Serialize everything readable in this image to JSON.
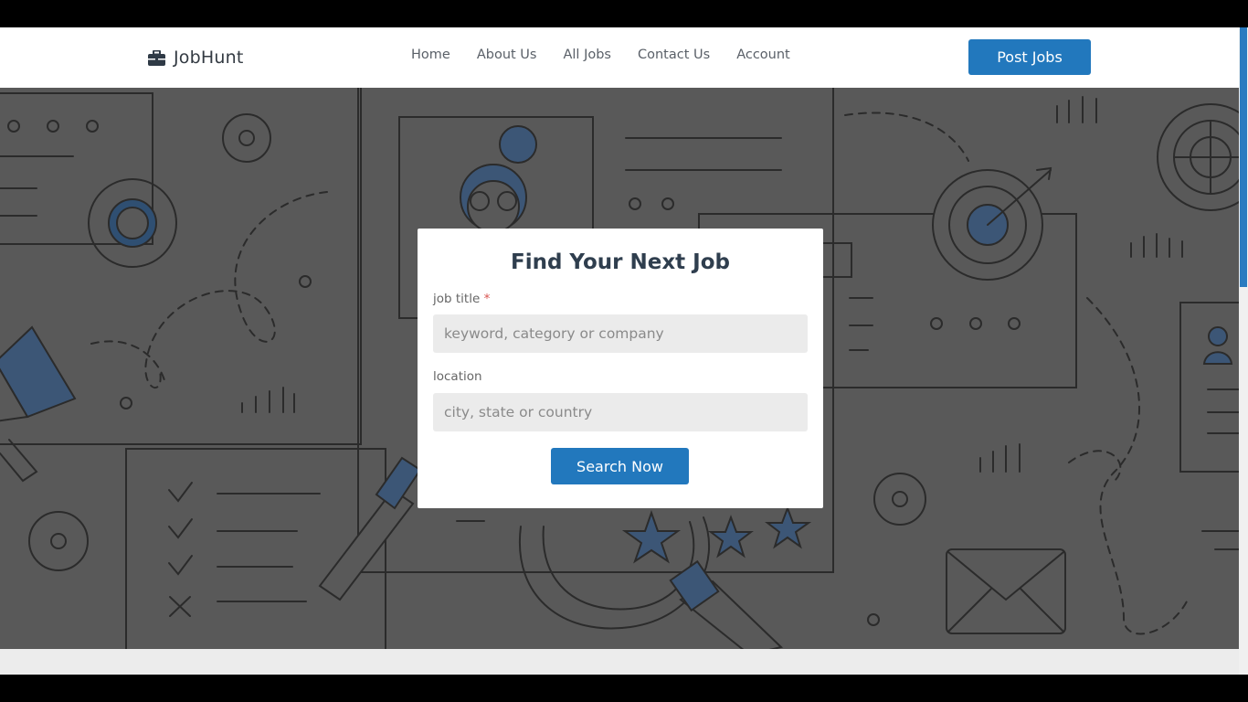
{
  "navbar": {
    "brand": "JobHunt",
    "brand_icon": "briefcase-icon",
    "links": [
      "Home",
      "About Us",
      "All Jobs",
      "Contact Us",
      "Account"
    ],
    "cta": "Post Jobs"
  },
  "search_card": {
    "title": "Find Your Next Job",
    "job_title_label": "job title",
    "required_mark": "*",
    "job_title_placeholder": "keyword, category or company",
    "location_label": "location",
    "location_placeholder": "city, state or country",
    "button": "Search Now"
  },
  "colors": {
    "accent": "#2278bd",
    "hero_overlay": "#595959",
    "navbar_bg": "#ffffff"
  }
}
